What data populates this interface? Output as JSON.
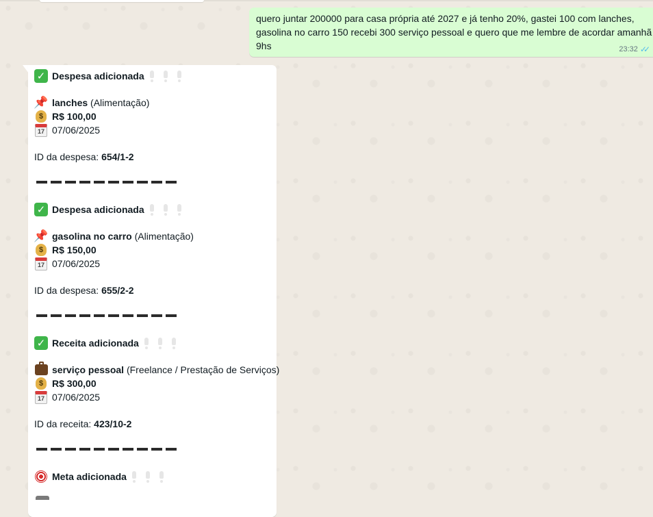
{
  "outgoing": {
    "text": "quero juntar 200000 para casa própria até 2027 e já tenho 20%, gastei 100 com lanches,\ngasolina no carro 150 recebi 300 serviço pessoal e quero que me lembre de acordar amanhã\n9hs",
    "time": "23:32",
    "status": "read"
  },
  "blocks": [
    {
      "title": "Despesa adicionada",
      "icon": "check-mark-icon",
      "name": "lanches",
      "category": "(Alimentação)",
      "item_icon": "pushpin-icon",
      "amount": "R$ 100,00",
      "date": "07/06/2025",
      "id_label": "ID da despesa:",
      "id_value": "654/1-2"
    },
    {
      "title": "Despesa adicionada",
      "icon": "check-mark-icon",
      "name": "gasolina no carro",
      "category": "(Alimentação)",
      "item_icon": "pushpin-icon",
      "amount": "R$ 150,00",
      "date": "07/06/2025",
      "id_label": "ID da despesa:",
      "id_value": "655/2-2"
    },
    {
      "title": "Receita adicionada",
      "icon": "check-mark-icon",
      "name": "serviço pessoal",
      "category": "(Freelance / Prestação de Serviços)",
      "item_icon": "briefcase-icon",
      "amount": "R$ 300,00",
      "date": "07/06/2025",
      "id_label": "ID da receita:",
      "id_value": "423/10-2"
    }
  ],
  "goal": {
    "title": "Meta adicionada",
    "icon": "target-icon"
  },
  "calendar_day": "17",
  "colors": {
    "chat_background": "#efeae2",
    "outgoing_bubble": "#d9fdd3",
    "incoming_bubble": "#ffffff",
    "read_ticks": "#53bdeb"
  }
}
